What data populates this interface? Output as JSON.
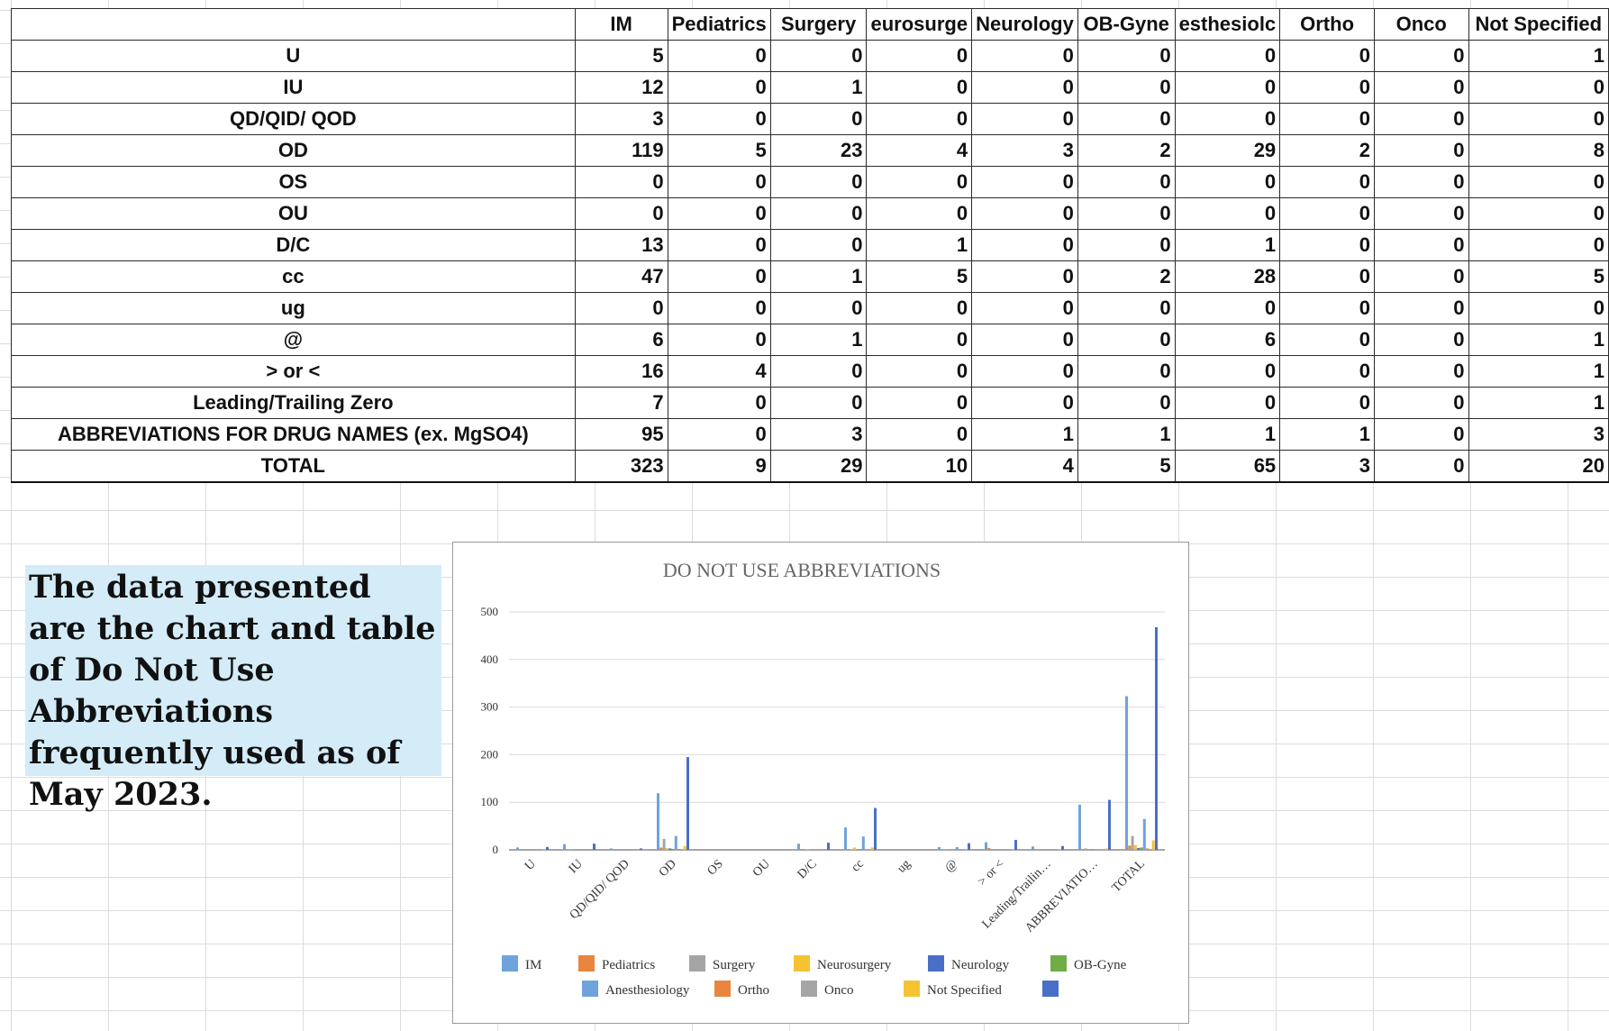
{
  "table": {
    "headers": [
      "",
      "IM",
      "Pediatrics",
      "Surgery",
      "eurosurge",
      "Neurology",
      "OB-Gyne",
      "esthesiolc",
      "Ortho",
      "Onco",
      "Not Specified"
    ],
    "rows": [
      {
        "label": "U",
        "values": [
          5,
          0,
          0,
          0,
          0,
          0,
          0,
          0,
          0,
          1
        ]
      },
      {
        "label": "IU",
        "values": [
          12,
          0,
          1,
          0,
          0,
          0,
          0,
          0,
          0,
          0
        ]
      },
      {
        "label": "QD/QID/ QOD",
        "values": [
          3,
          0,
          0,
          0,
          0,
          0,
          0,
          0,
          0,
          0
        ]
      },
      {
        "label": "OD",
        "values": [
          119,
          5,
          23,
          4,
          3,
          2,
          29,
          2,
          0,
          8
        ]
      },
      {
        "label": "OS",
        "values": [
          0,
          0,
          0,
          0,
          0,
          0,
          0,
          0,
          0,
          0
        ]
      },
      {
        "label": "OU",
        "values": [
          0,
          0,
          0,
          0,
          0,
          0,
          0,
          0,
          0,
          0
        ]
      },
      {
        "label": "D/C",
        "values": [
          13,
          0,
          0,
          1,
          0,
          0,
          1,
          0,
          0,
          0
        ]
      },
      {
        "label": "cc",
        "values": [
          47,
          0,
          1,
          5,
          0,
          2,
          28,
          0,
          0,
          5
        ]
      },
      {
        "label": "ug",
        "values": [
          0,
          0,
          0,
          0,
          0,
          0,
          0,
          0,
          0,
          0
        ]
      },
      {
        "label": "@",
        "values": [
          6,
          0,
          1,
          0,
          0,
          0,
          6,
          0,
          0,
          1
        ]
      },
      {
        "label": "> or <",
        "values": [
          16,
          4,
          0,
          0,
          0,
          0,
          0,
          0,
          0,
          1
        ]
      },
      {
        "label": "Leading/Trailing Zero",
        "values": [
          7,
          0,
          0,
          0,
          0,
          0,
          0,
          0,
          0,
          1
        ]
      },
      {
        "label": "ABBREVIATIONS FOR DRUG NAMES (ex. MgSO4)",
        "values": [
          95,
          0,
          3,
          0,
          1,
          1,
          1,
          1,
          0,
          3
        ]
      },
      {
        "label": "TOTAL",
        "values": [
          323,
          9,
          29,
          10,
          4,
          5,
          65,
          3,
          0,
          20
        ]
      }
    ]
  },
  "note": {
    "text": "The data presented are the chart and table of Do Not Use Abbreviations frequently used as of May 2023."
  },
  "chart_data": {
    "type": "bar",
    "title": "DO NOT USE ABBREVIATIONS",
    "xlabel": "",
    "ylabel": "",
    "ylim": [
      0,
      500
    ],
    "yticks": [
      0,
      100,
      200,
      300,
      400,
      500
    ],
    "grid": true,
    "legend_position": "bottom",
    "categories": [
      "U",
      "IU",
      "QD/QID/ QOD",
      "OD",
      "OS",
      "OU",
      "D/C",
      "cc",
      "ug",
      "@",
      "> or <",
      "Leading/Trailin…",
      "ABBREVIATIO…",
      "TOTAL"
    ],
    "series": [
      {
        "name": "IM",
        "color": "#6fa3dc",
        "values": [
          5,
          12,
          3,
          119,
          0,
          0,
          13,
          47,
          0,
          6,
          16,
          7,
          95,
          323
        ]
      },
      {
        "name": "Pediatrics",
        "color": "#e8853e",
        "values": [
          0,
          0,
          0,
          5,
          0,
          0,
          0,
          0,
          0,
          0,
          4,
          0,
          0,
          9
        ]
      },
      {
        "name": "Surgery",
        "color": "#a5a5a5",
        "values": [
          0,
          1,
          0,
          23,
          0,
          0,
          0,
          1,
          0,
          1,
          0,
          0,
          3,
          29
        ]
      },
      {
        "name": "Neurosurgery",
        "color": "#f5c332",
        "values": [
          0,
          0,
          0,
          4,
          0,
          0,
          1,
          5,
          0,
          0,
          0,
          0,
          0,
          10
        ]
      },
      {
        "name": "Neurology",
        "color": "#4a6fc7",
        "values": [
          0,
          0,
          0,
          3,
          0,
          0,
          0,
          0,
          0,
          0,
          0,
          0,
          1,
          4
        ]
      },
      {
        "name": "OB-Gyne",
        "color": "#70ad47",
        "values": [
          0,
          0,
          0,
          2,
          0,
          0,
          0,
          2,
          0,
          0,
          0,
          0,
          1,
          5
        ]
      },
      {
        "name": "Anesthesiology",
        "color": "#6fa3dc",
        "values": [
          0,
          0,
          0,
          29,
          0,
          0,
          1,
          28,
          0,
          6,
          0,
          0,
          1,
          65
        ]
      },
      {
        "name": "Ortho",
        "color": "#e8853e",
        "values": [
          0,
          0,
          0,
          2,
          0,
          0,
          0,
          0,
          0,
          0,
          0,
          0,
          1,
          3
        ]
      },
      {
        "name": "Onco",
        "color": "#a5a5a5",
        "values": [
          0,
          0,
          0,
          0,
          0,
          0,
          0,
          0,
          0,
          0,
          0,
          0,
          0,
          0
        ]
      },
      {
        "name": "Not Specified",
        "color": "#f5c332",
        "values": [
          1,
          0,
          0,
          8,
          0,
          0,
          0,
          5,
          0,
          1,
          1,
          1,
          3,
          20
        ]
      },
      {
        "name": "",
        "color": "#4a6fc7",
        "values": [
          6,
          13,
          3,
          195,
          0,
          0,
          15,
          88,
          0,
          14,
          21,
          8,
          105,
          468
        ]
      }
    ]
  }
}
